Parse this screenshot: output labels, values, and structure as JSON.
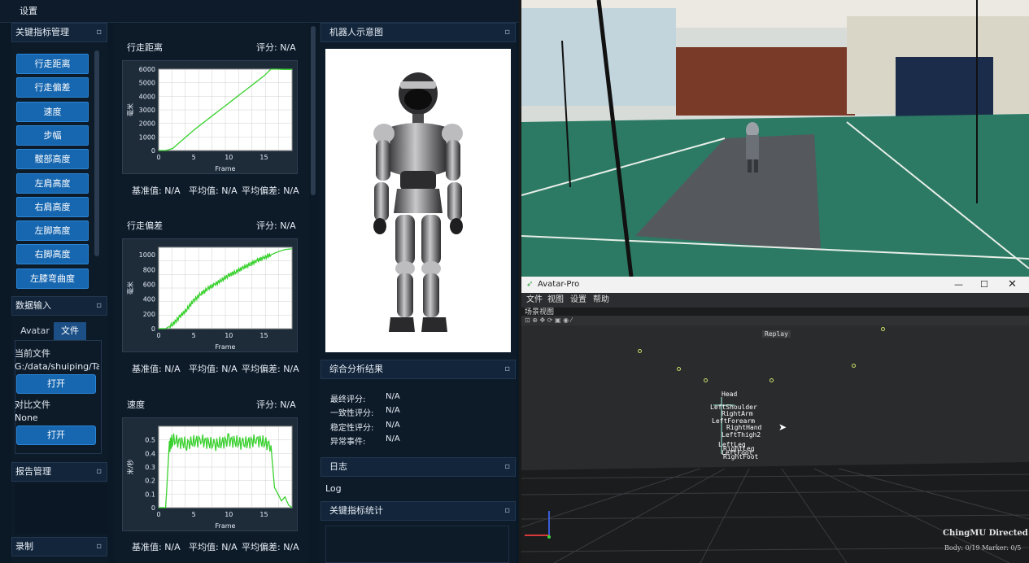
{
  "topbar": {
    "title": "设置"
  },
  "key_metrics": {
    "header": "关键指标管理",
    "items": [
      "行走距离",
      "行走偏差",
      "速度",
      "步幅",
      "髋部高度",
      "左肩高度",
      "右肩高度",
      "左脚高度",
      "右脚高度",
      "左膝弯曲度"
    ]
  },
  "data_input": {
    "header": "数据输入",
    "tabs": [
      "Avatar",
      "文件"
    ],
    "current_file_label": "当前文件",
    "current_file_value": "G:/data/shuiping/Take",
    "open_label": "打开",
    "compare_label": "对比文件",
    "compare_value": "None",
    "open2_label": "打开"
  },
  "report": {
    "header": "报告管理"
  },
  "record": {
    "header": "录制"
  },
  "charts": {
    "c1": {
      "title": "行走距离",
      "score": "评分:  N/A",
      "xlabel": "Frame",
      "ylabel": "毫米",
      "baseline": "基准值: N/A",
      "mean": "平均值: N/A",
      "dev": "平均偏差: N/A",
      "yticks": [
        "6000",
        "5000",
        "4000",
        "3000",
        "2000",
        "1000",
        "0"
      ],
      "xticks": [
        "0",
        "5",
        "10",
        "15"
      ]
    },
    "c2": {
      "title": "行走偏差",
      "score": "评分:  N/A",
      "xlabel": "Frame",
      "ylabel": "毫米",
      "baseline": "基准值: N/A",
      "mean": "平均值: N/A",
      "dev": "平均偏差: N/A",
      "yticks": [
        "1000",
        "800",
        "600",
        "400",
        "200",
        "0"
      ],
      "xticks": [
        "0",
        "5",
        "10",
        "15"
      ]
    },
    "c3": {
      "title": "速度",
      "score": "评分:  N/A",
      "xlabel": "Frame",
      "ylabel": "米/秒",
      "baseline": "基准值: N/A",
      "mean": "平均值: N/A",
      "dev": "平均偏差: N/A",
      "yticks": [
        "0.5",
        "0.4",
        "0.3",
        "0.2",
        "0.1",
        "0"
      ],
      "xticks": [
        "0",
        "5",
        "10",
        "15"
      ]
    }
  },
  "chart_data": [
    {
      "type": "line",
      "title": "行走距离",
      "xlabel": "Frame",
      "ylabel": "毫米",
      "xlim": [
        0,
        19
      ],
      "ylim": [
        0,
        6000
      ],
      "x": [
        0,
        1,
        2,
        5,
        10,
        15,
        16,
        17,
        18,
        19
      ],
      "y": [
        0,
        0,
        150,
        1500,
        3500,
        5500,
        6000,
        6000,
        5980,
        5980
      ],
      "series": [
        {
          "color": "#39d12e"
        }
      ]
    },
    {
      "type": "line",
      "title": "行走偏差",
      "xlabel": "Frame",
      "ylabel": "毫米",
      "xlim": [
        0,
        19
      ],
      "ylim": [
        0,
        1100
      ],
      "x": [
        0,
        1,
        2,
        3,
        4,
        5,
        6,
        7,
        8,
        9,
        10,
        11,
        12,
        13,
        14,
        15,
        16,
        17,
        18,
        19
      ],
      "y": [
        0,
        0,
        60,
        160,
        260,
        380,
        470,
        540,
        600,
        660,
        720,
        770,
        820,
        870,
        920,
        960,
        1000,
        1040,
        1070,
        1080
      ],
      "series": [
        {
          "color": "#39d12e"
        }
      ]
    },
    {
      "type": "line",
      "title": "速度",
      "xlabel": "Frame",
      "ylabel": "米/秒",
      "xlim": [
        0,
        19
      ],
      "ylim": [
        0,
        0.6
      ],
      "x": [
        0,
        1,
        1.5,
        2,
        4,
        6,
        8,
        10,
        12,
        14,
        16,
        16.5,
        17,
        17.5,
        18,
        18.5,
        19
      ],
      "y": [
        0,
        0,
        0.45,
        0.5,
        0.47,
        0.5,
        0.46,
        0.5,
        0.47,
        0.5,
        0.46,
        0.15,
        0.1,
        0.05,
        0.08,
        0.02,
        0
      ],
      "series": [
        {
          "color": "#39d12e"
        }
      ]
    }
  ],
  "robot_panel": {
    "header": "机器人示意图"
  },
  "analysis": {
    "header": "综合分析结果",
    "rows": [
      {
        "k": "最终评分:",
        "v": "N/A"
      },
      {
        "k": "一致性评分:",
        "v": "N/A"
      },
      {
        "k": "稳定性评分:",
        "v": "N/A"
      },
      {
        "k": "异常事件:",
        "v": "N/A"
      }
    ]
  },
  "log": {
    "header": "日志",
    "text": "Log"
  },
  "stats": {
    "header": "关键指标统计"
  },
  "avatar": {
    "title": "Avatar-Pro",
    "menu": [
      "文件",
      "视图",
      "设置",
      "帮助"
    ],
    "view_label": "场景视图",
    "replay": "Replay",
    "brand": "ChingMU Directed",
    "status": "Body: 0/19  Marker: 0/5",
    "joints": [
      "Head",
      "LeftShoulder",
      "RightArm",
      "LeftForearm",
      "RightHand",
      "LeftThigh2",
      "LeftLeg",
      "RightLeg",
      "LeftFoot",
      "RightFoot"
    ]
  },
  "colors": {
    "accent": "#1767b0",
    "line": "#39d12e",
    "panel": "#0d1a28"
  }
}
